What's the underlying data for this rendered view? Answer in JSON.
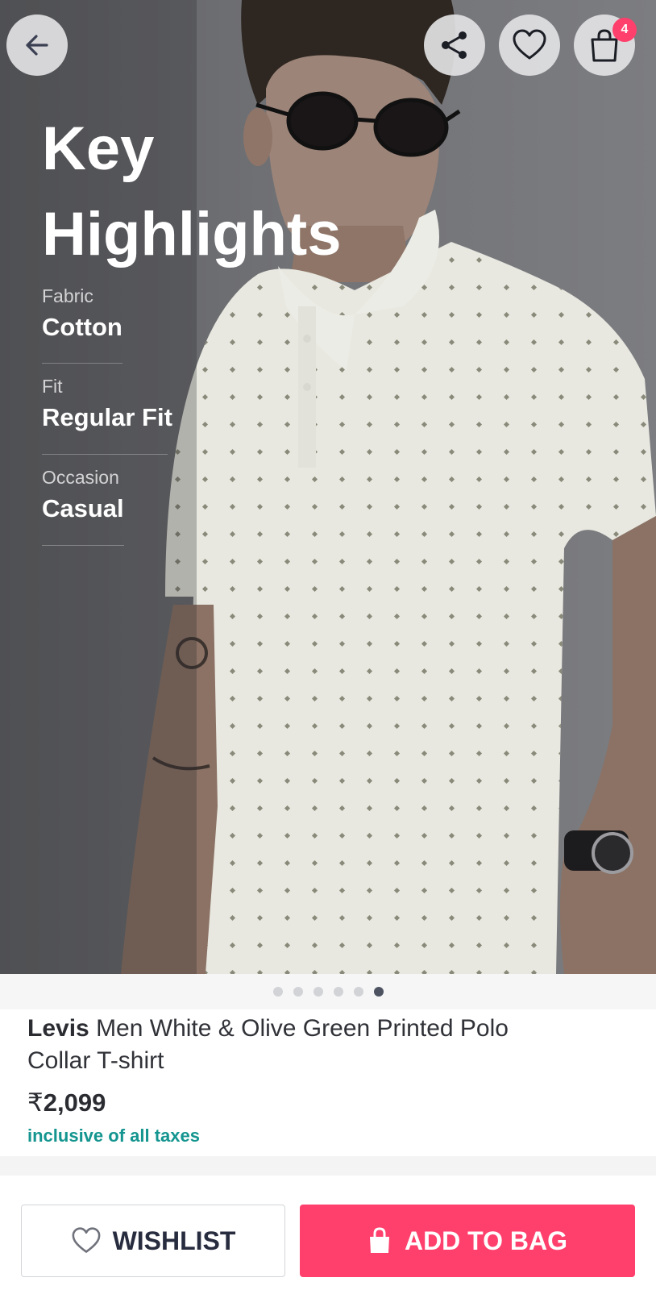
{
  "header": {
    "back_icon": "arrow-left-icon",
    "share_icon": "share-icon",
    "wishlist_icon": "heart-outline-icon",
    "bag_icon": "shopping-bag-icon",
    "bag_count": "4"
  },
  "highlights": {
    "title": "Key Highlights",
    "items": [
      {
        "label": "Fabric",
        "value": "Cotton"
      },
      {
        "label": "Fit",
        "value": "Regular Fit"
      },
      {
        "label": "Occasion",
        "value": "Casual"
      }
    ]
  },
  "carousel": {
    "total_dots": 6,
    "active_index": 5
  },
  "product": {
    "brand": "Levis",
    "name": "Men White & Olive Green Printed Polo Collar T-shirt",
    "currency": "₹",
    "price": "2,099",
    "tax_note": "inclusive of all taxes"
  },
  "actions": {
    "wishlist_label": "WISHLIST",
    "add_to_bag_label": "ADD TO BAG"
  },
  "colors": {
    "accent": "#ff3f6c",
    "tax_green": "#14958f",
    "text_dark": "#282c3f"
  }
}
